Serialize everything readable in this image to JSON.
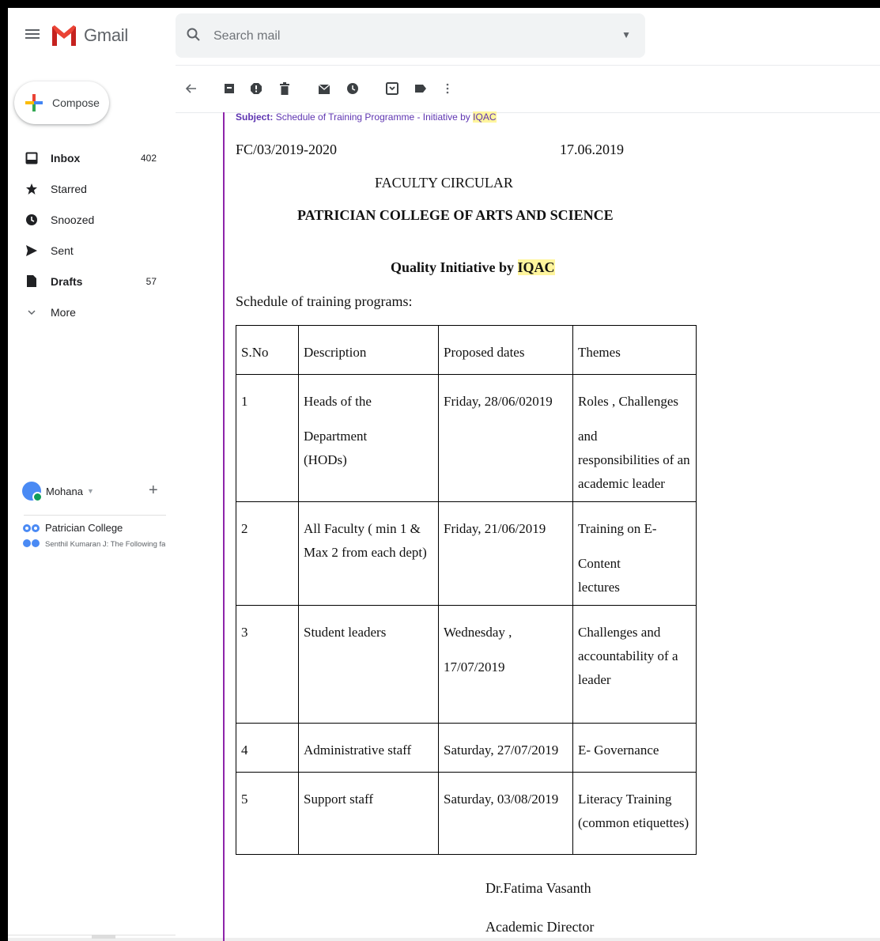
{
  "header": {
    "app_name": "Gmail",
    "search_placeholder": "Search mail"
  },
  "sidebar": {
    "compose_label": "Compose",
    "items": [
      {
        "label": "Inbox",
        "count": "402",
        "icon": "inbox-icon"
      },
      {
        "label": "Starred",
        "count": "",
        "icon": "star-icon"
      },
      {
        "label": "Snoozed",
        "count": "",
        "icon": "clock-icon"
      },
      {
        "label": "Sent",
        "count": "",
        "icon": "send-icon"
      },
      {
        "label": "Drafts",
        "count": "57",
        "icon": "draft-icon"
      },
      {
        "label": "More",
        "count": "",
        "icon": "chevron-down-icon"
      }
    ]
  },
  "hangouts": {
    "user": "Mohana",
    "chat_title": "Patrician College",
    "chat_snippet": "Senthil Kumaran J: The Following faculty"
  },
  "toolbar": {
    "icons": [
      "back-arrow-icon",
      "archive-icon",
      "report-spam-icon",
      "delete-icon",
      "mark-unread-icon",
      "snooze-icon",
      "move-to-icon",
      "label-icon",
      "more-icon"
    ]
  },
  "email": {
    "subject_label": "Subject:",
    "subject_text": "Schedule of Training Programme - Initiative by",
    "subject_highlight": "IQAC",
    "ref_no": "FC/03/2019-2020",
    "date": "17.06.2019",
    "circular_title": "FACULTY CIRCULAR",
    "college": "PATRICIAN COLLEGE OF ARTS AND SCIENCE",
    "quality_prefix": "Quality Initiative by",
    "quality_highlight": "IQAC",
    "schedule_intro": "Schedule of training programs:",
    "table": {
      "headers": [
        "S.No",
        "Description",
        "Proposed dates",
        "Themes"
      ],
      "rows": [
        {
          "sno": "1",
          "description": [
            "Heads of the Department",
            "(HODs)"
          ],
          "date": "Friday,  28/06/02019",
          "theme": [
            "Roles , Challenges and",
            "responsibilities of an",
            "academic leader"
          ]
        },
        {
          "sno": "2",
          "description": [
            "All Faculty ( min 1 &",
            "Max 2 from each dept)"
          ],
          "date": "Friday, 21/06/2019",
          "theme": [
            "Training on E-Content",
            "lectures"
          ]
        },
        {
          "sno": "3",
          "description": [
            "Student leaders"
          ],
          "date": "Wednesday , 17/07/2019",
          "theme": [
            "Challenges and",
            "accountability of a",
            "leader"
          ]
        },
        {
          "sno": "4",
          "description": [
            "Administrative staff"
          ],
          "date": "Saturday, 27/07/2019",
          "theme": [
            "E- Governance"
          ]
        },
        {
          "sno": "5",
          "description": [
            "Support staff"
          ],
          "date": "Saturday, 03/08/2019",
          "theme": [
            "Literacy Training",
            "(common etiquettes)"
          ]
        }
      ]
    },
    "signer": "Dr.Fatima Vasanth",
    "signer_title": "Academic Director"
  },
  "colors": {
    "gmail_red": "#ea4335",
    "accent_purple": "#8e24aa",
    "highlight_yellow": "#fff59d"
  }
}
